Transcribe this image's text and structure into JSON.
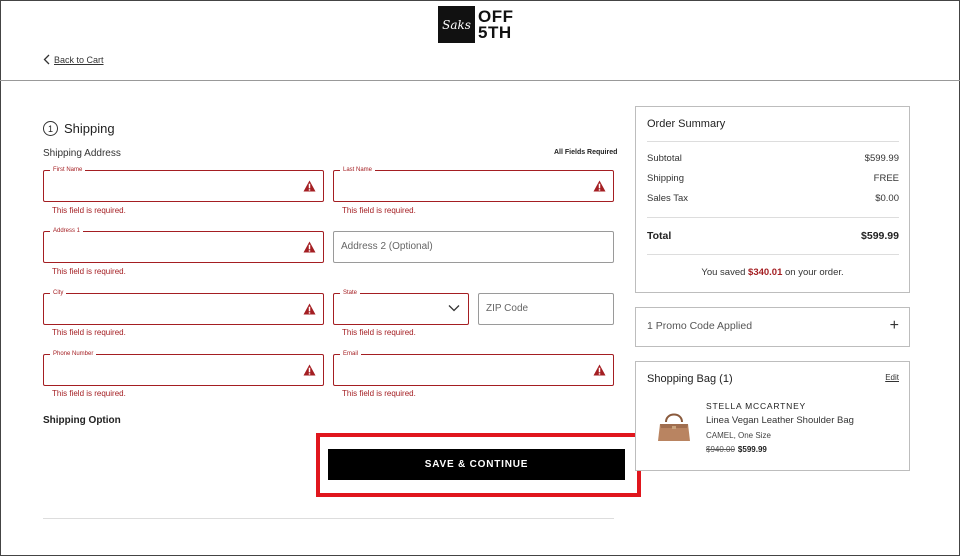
{
  "header": {
    "logo_mark": "Saks",
    "logo_line1": "OFF",
    "logo_line2": "5TH",
    "back_label": "Back to Cart"
  },
  "shipping": {
    "step_number": "1",
    "title": "Shipping",
    "address_label": "Shipping Address",
    "all_required": "All Fields Required",
    "fields": {
      "first_name": {
        "label": "First Name",
        "error": "This field is required."
      },
      "last_name": {
        "label": "Last Name",
        "error": "This field is required."
      },
      "address1": {
        "label": "Address 1",
        "error": "This field is required."
      },
      "address2": {
        "placeholder": "Address 2 (Optional)"
      },
      "city": {
        "label": "City",
        "error": "This field is required."
      },
      "state": {
        "label": "State",
        "error": "This field is required."
      },
      "zip": {
        "placeholder": "ZIP Code"
      },
      "phone": {
        "label": "Phone Number",
        "error": "This field is required."
      },
      "email": {
        "label": "Email",
        "error": "This field is required."
      }
    },
    "option_label": "Shipping Option",
    "cta_label": "SAVE & CONTINUE"
  },
  "summary": {
    "title": "Order Summary",
    "subtotal_label": "Subtotal",
    "subtotal_value": "$599.99",
    "shipping_label": "Shipping",
    "shipping_value": "FREE",
    "tax_label": "Sales Tax",
    "tax_value": "$0.00",
    "total_label": "Total",
    "total_value": "$599.99",
    "saved_prefix": "You saved ",
    "saved_amount": "$340.01",
    "saved_suffix": " on your order."
  },
  "promo": {
    "label": "1 Promo Code Applied",
    "toggle": "+"
  },
  "bag": {
    "title": "Shopping Bag (1)",
    "edit_label": "Edit",
    "item": {
      "brand": "STELLA MCCARTNEY",
      "name": "Linea Vegan Leather Shoulder Bag",
      "variant": "CAMEL, One Size",
      "original_price": "$940.00",
      "sale_price": "$599.99"
    }
  },
  "colors": {
    "error": "#a41e22",
    "highlight": "#e0161d",
    "cta_bg": "#000000",
    "product": "#b98461"
  }
}
